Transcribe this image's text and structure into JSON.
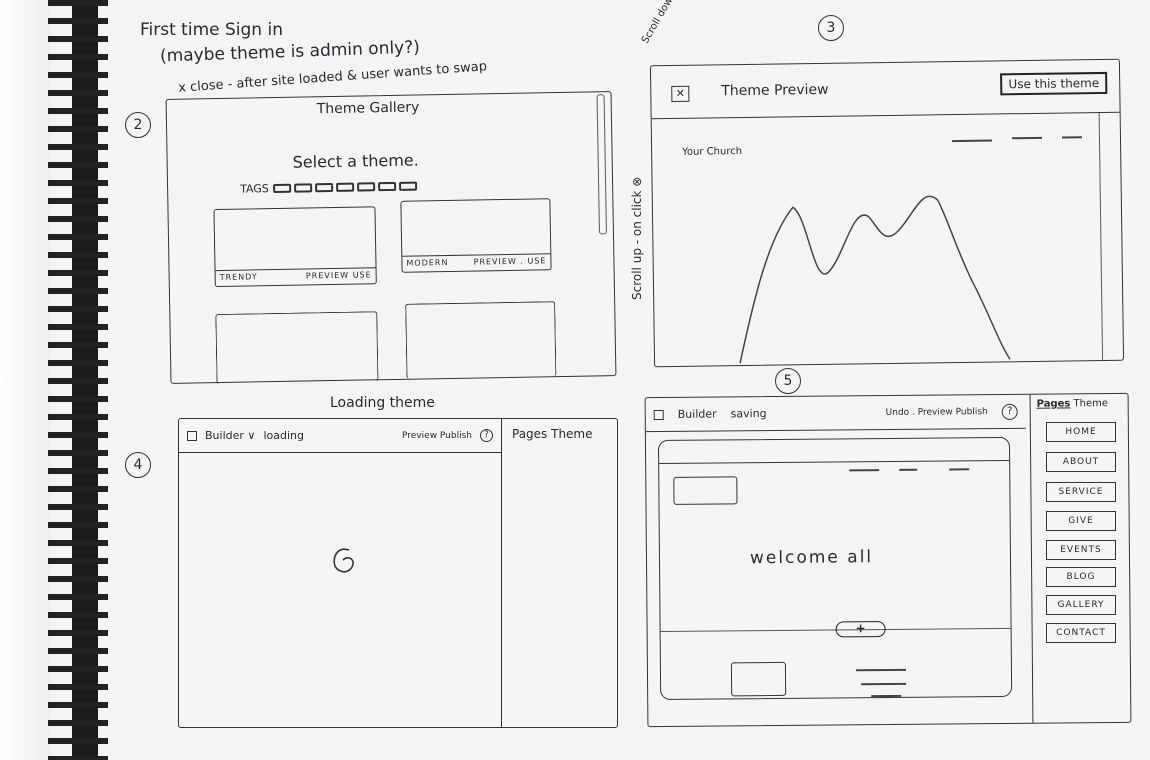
{
  "notes": {
    "title_line1": "First time Sign in",
    "title_line2": "(maybe theme is admin only?)",
    "close_note": "x close - after site loaded & user wants to swap",
    "scroll_up_note": "Scroll up - on click ⊗",
    "scroll_down_note": "Scroll down to review previous page"
  },
  "panel_gallery": {
    "number": "2",
    "title": "Theme Gallery",
    "heading": "Select a theme.",
    "tags_label": "TAGS",
    "cards": [
      {
        "name": "TRENDY",
        "actions": "PREVIEW USE"
      },
      {
        "name": "MODERN",
        "actions": "PREVIEW . USE"
      }
    ]
  },
  "panel_preview": {
    "number": "3",
    "title": "Theme Preview",
    "use_button": "Use this theme",
    "site_name": "Your Church"
  },
  "panel_loading": {
    "number": "4",
    "caption": "Loading theme",
    "builder_label": "Builder ∨",
    "status": "loading",
    "actions": "Preview Publish",
    "help": "?",
    "side_tabs": "Pages Theme"
  },
  "panel_builder": {
    "number": "5",
    "builder_label": "Builder",
    "status": "saving",
    "actions": "Undo . Preview Publish",
    "help": "?",
    "tab_pages": "Pages",
    "tab_theme": "Theme",
    "welcome": "welcome all",
    "add": "+",
    "pages": [
      "HOME",
      "ABOUT",
      "SERVICE",
      "GIVE",
      "EVENTS",
      "BLOG",
      "GALLERY",
      "CONTACT"
    ]
  }
}
